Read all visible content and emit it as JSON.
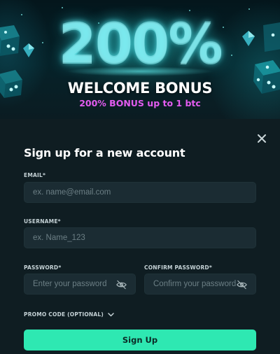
{
  "banner": {
    "big_number": "200%",
    "headline": "WELCOME BONUS",
    "subline": "200% BONUS up to 1 btc",
    "accent_color": "#e35cf0"
  },
  "modal": {
    "title": "Sign up for a new account",
    "close_icon": "close-icon"
  },
  "form": {
    "email": {
      "label": "EMAIL*",
      "placeholder": "ex. name@email.com",
      "value": ""
    },
    "username": {
      "label": "USERNAME*",
      "placeholder": "ex. Name_123",
      "value": ""
    },
    "password": {
      "label": "PASSWORD*",
      "placeholder": "Enter your password",
      "value": "",
      "toggle_icon": "eye-off-icon"
    },
    "confirm_password": {
      "label": "CONFIRM PASSWORD*",
      "placeholder": "Confirm your password",
      "value": "",
      "toggle_icon": "eye-off-icon"
    },
    "promo": {
      "label": "PROMO CODE (OPTIONAL)",
      "icon": "chevron-down-icon"
    },
    "submit_label": "Sign Up",
    "submit_color": "#2ee8b2"
  }
}
